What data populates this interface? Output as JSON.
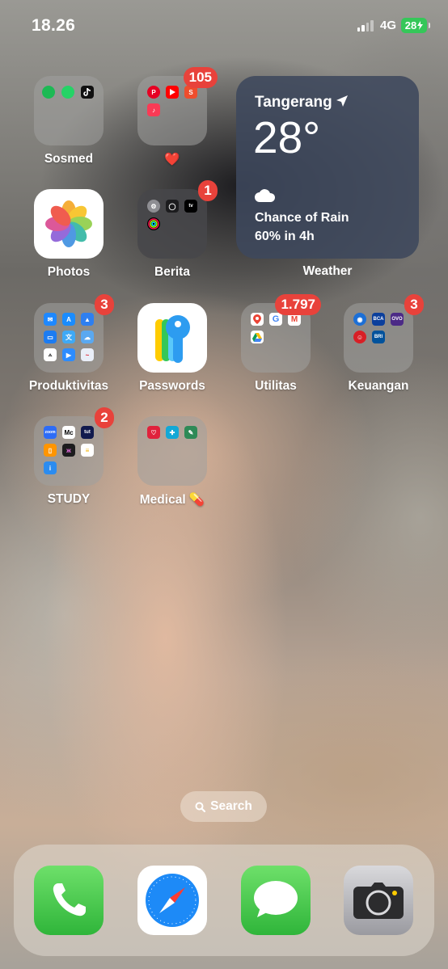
{
  "status_bar": {
    "time": "18.26",
    "network": "4G",
    "battery": "28"
  },
  "apps": {
    "sosmed": {
      "label": "Sosmed"
    },
    "favorites": {
      "label": "❤️",
      "badge": "105"
    },
    "photos": {
      "label": "Photos"
    },
    "berita": {
      "label": "Berita",
      "badge": "1"
    },
    "produktivitas": {
      "label": "Produktivitas",
      "badge": "3"
    },
    "passwords": {
      "label": "Passwords"
    },
    "utilitas": {
      "label": "Utilitas",
      "badge": "1.797"
    },
    "keuangan": {
      "label": "Keuangan",
      "badge": "3"
    },
    "study": {
      "label": "STUDY",
      "badge": "2"
    },
    "medical": {
      "label": "Medical 💊"
    }
  },
  "folder_minis": {
    "keuangan_bca": "BCA",
    "keuangan_ovo": "OVO",
    "keuangan_bri": "BRI",
    "study_zoom": "zoom",
    "study_m": "Mc",
    "study_tut": "tut"
  },
  "weather_widget": {
    "city": "Tangerang",
    "temperature": "28°",
    "condition_line1": "Chance of Rain",
    "condition_line2": "60% in 4h",
    "label": "Weather"
  },
  "search": {
    "label": "Search"
  },
  "dock": [
    "Phone",
    "Safari",
    "Messages",
    "Camera"
  ],
  "colors": {
    "badge": "#e8423b",
    "battery": "#35c759",
    "widget": "#3e485c"
  }
}
